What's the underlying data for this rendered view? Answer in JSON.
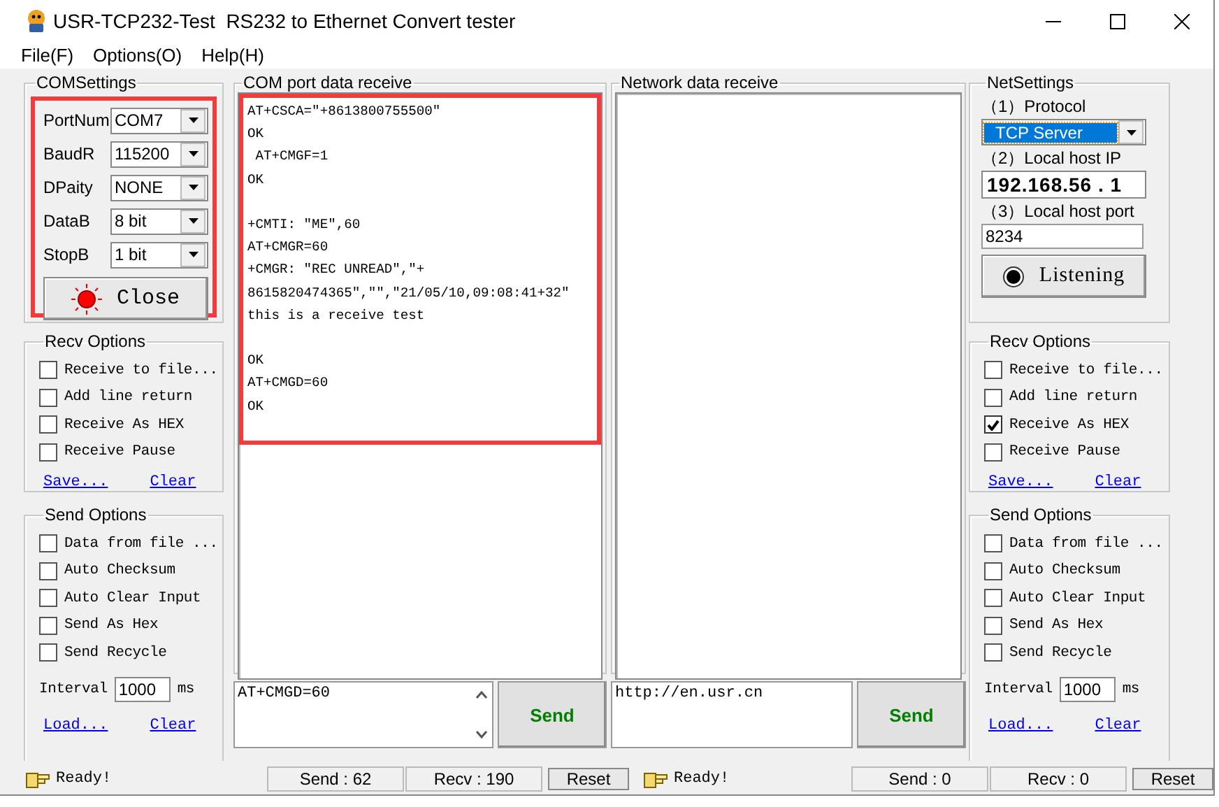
{
  "window": {
    "title": "USR-TCP232-Test  RS232 to Ethernet Convert tester"
  },
  "menu": [
    "File(F)",
    "Options(O)",
    "Help(H)"
  ],
  "com_settings": {
    "title": "COMSettings",
    "highlighted": true,
    "fields": [
      {
        "label": "PortNum",
        "value": "COM7"
      },
      {
        "label": "BaudR",
        "value": "115200"
      },
      {
        "label": "DPaity",
        "value": "NONE"
      },
      {
        "label": "DataB",
        "value": "8 bit"
      },
      {
        "label": "StopB",
        "value": "1 bit"
      }
    ],
    "button": {
      "label": "Close",
      "active": true
    }
  },
  "recv_options_left": {
    "title": "Recv Options",
    "options": [
      {
        "label": "Receive to file...",
        "checked": false
      },
      {
        "label": "Add line return",
        "checked": false
      },
      {
        "label": "Receive As HEX",
        "checked": false
      },
      {
        "label": "Receive Pause",
        "checked": false
      }
    ],
    "links": [
      "Save...",
      "Clear"
    ]
  },
  "send_options_left": {
    "title": "Send Options",
    "options": [
      {
        "label": "Data from file ...",
        "checked": false
      },
      {
        "label": "Auto Checksum",
        "checked": false
      },
      {
        "label": "Auto Clear Input",
        "checked": false
      },
      {
        "label": "Send As Hex",
        "checked": false
      },
      {
        "label": "Send Recycle",
        "checked": false
      }
    ],
    "interval_label": "Interval",
    "interval": "1000",
    "unit": "ms",
    "links": [
      "Load...",
      "Clear"
    ]
  },
  "com_receive": {
    "title": "COM port data receive",
    "highlighted": true,
    "text": "AT+CSCA=\"+8613800755500\"\nOK\n AT+CMGF=1\nOK\n\n+CMTI: \"ME\",60\nAT+CMGR=60\n+CMGR: \"REC UNREAD\",\"+\n8615820474365\",\"\",\"21/05/10,09:08:41+32\"\nthis is a receive test\n\nOK\nAT+CMGD=60\nOK"
  },
  "com_send": {
    "value": "AT+CMGD=60",
    "button": "Send"
  },
  "net_receive": {
    "title": "Network data receive"
  },
  "net_send": {
    "value": "http://en.usr.cn",
    "button": "Send"
  },
  "net_settings": {
    "title": "NetSettings",
    "protocol_label": "（1）Protocol",
    "protocol": "TCP Server",
    "ip_label": "（2）Local host IP",
    "ip": "192.168.56 . 1",
    "port_label": "（3）Local host port",
    "port": "8234",
    "button": {
      "label": "Listening",
      "active": false
    }
  },
  "recv_options_right": {
    "title": "Recv Options",
    "options": [
      {
        "label": "Receive to file...",
        "checked": false
      },
      {
        "label": "Add line return",
        "checked": false
      },
      {
        "label": "Receive As HEX",
        "checked": true
      },
      {
        "label": "Receive Pause",
        "checked": false
      }
    ],
    "links": [
      "Save...",
      "Clear"
    ]
  },
  "send_options_right": {
    "title": "Send Options",
    "options": [
      {
        "label": "Data from file ...",
        "checked": false
      },
      {
        "label": "Auto Checksum",
        "checked": false
      },
      {
        "label": "Auto Clear Input",
        "checked": false
      },
      {
        "label": "Send As Hex",
        "checked": false
      },
      {
        "label": "Send Recycle",
        "checked": false
      }
    ],
    "interval_label": "Interval",
    "interval": "1000",
    "unit": "ms",
    "links": [
      "Load...",
      "Clear"
    ]
  },
  "status_left": {
    "message": "Ready!",
    "send": "Send : 62",
    "recv": "Recv : 190",
    "reset": "Reset"
  },
  "status_right": {
    "message": "Ready!",
    "send": "Send : 0",
    "recv": "Recv : 0",
    "reset": "Reset"
  }
}
